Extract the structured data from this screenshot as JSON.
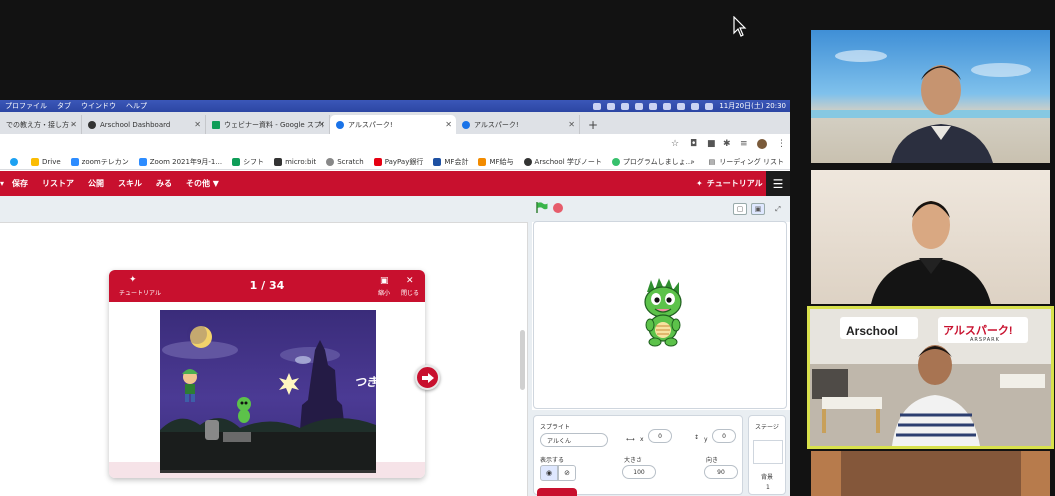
{
  "menubar": {
    "items": [
      "プロファイル",
      "タブ",
      "ウインドウ",
      "ヘルプ"
    ],
    "clock": "11月20日(土)  20:30"
  },
  "tabs": [
    {
      "label": "での教え方・接し方 - ...",
      "color": "#4caf50"
    },
    {
      "label": "Arschool Dashboard",
      "color": "#333333"
    },
    {
      "label": "ウェビナー資料 - Google スプレ...",
      "color": "#0f9d58"
    },
    {
      "label": "アルスパーク!",
      "color": "#1a73e8"
    },
    {
      "label": "アルスパーク!",
      "color": "#1a73e8"
    }
  ],
  "bookmarks": {
    "items": [
      {
        "label": "Drive",
        "color": "#fbbc04"
      },
      {
        "label": "zoomテレカン",
        "color": "#2d8cff"
      },
      {
        "label": "Zoom 2021年9月-1...",
        "color": "#2d8cff"
      },
      {
        "label": "シフト",
        "color": "#0f9d58"
      },
      {
        "label": "micro:bit",
        "color": "#333333"
      },
      {
        "label": "Scratch",
        "color": "#888888"
      },
      {
        "label": "PayPay銀行",
        "color": "#e60012"
      },
      {
        "label": "MF会計",
        "color": "#1e50a2"
      },
      {
        "label": "MF給与",
        "color": "#f28b00"
      },
      {
        "label": "Arschool 学びノート",
        "color": "#333333"
      },
      {
        "label": "プログラムしましょ...",
        "color": "#37c06c"
      }
    ],
    "reading_list": "リーディング リスト"
  },
  "app_nav": {
    "items": [
      "保存",
      "リストア",
      "公開",
      "スキル",
      "みる"
    ],
    "more": "その他 ▼",
    "tutorial": "チュートリアル"
  },
  "tutorial_card": {
    "title": "チュートリアル",
    "page": "1 / 34",
    "minimize": "縮小",
    "close": "閉じる",
    "next_label": "つぎへ➡"
  },
  "sprite_panel": {
    "sprite_label": "スプライト",
    "sprite_name": "アルくん",
    "x_label": "x",
    "x_value": "0",
    "y_label": "y",
    "y_value": "0",
    "show_label": "表示する",
    "size_label": "大きさ",
    "size_value": "100",
    "direction_label": "向き",
    "direction_value": "90"
  },
  "stage_panel": {
    "label": "ステージ",
    "backdrop_label": "背景",
    "backdrop_count": "1"
  },
  "video_tiles": {
    "sign_arschool": "Arschool",
    "sign_arspark": "アルスパーク!",
    "sign_arspark_sub": "ARSPARK"
  },
  "colors": {
    "brand_red": "#c8102e",
    "highlight_border": "#d8e14c"
  }
}
